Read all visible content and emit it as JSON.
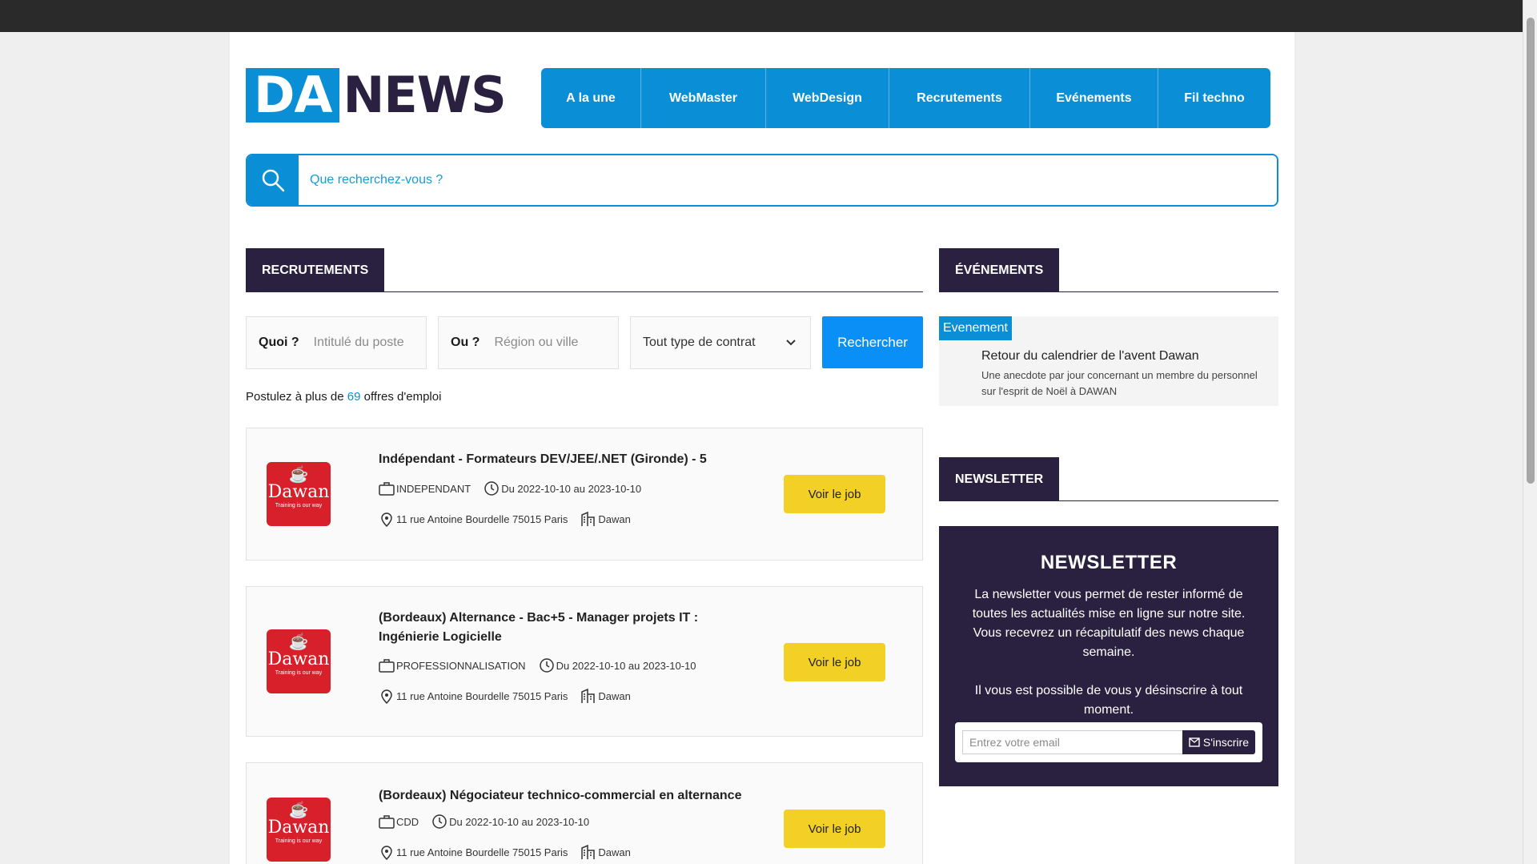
{
  "logo": {
    "part1": "DA",
    "part2": "NEWS"
  },
  "nav": [
    {
      "label": "A la une",
      "width": 125
    },
    {
      "label": "WebMaster",
      "width": 156
    },
    {
      "label": "WebDesign",
      "width": 154
    },
    {
      "label": "Recrutements",
      "width": 176
    },
    {
      "label": "Evénements",
      "width": 160
    },
    {
      "label": "Fil techno",
      "width": 140
    }
  ],
  "search": {
    "placeholder": "Que recherchez-vous ?"
  },
  "recrutements": {
    "heading": "RECRUTEMENTS",
    "quoi_label": "Quoi ?",
    "quoi_placeholder": "Intitulé du poste",
    "ou_label": "Ou ?",
    "ou_placeholder": "Région ou ville",
    "contract_select": "Tout type de contrat",
    "search_button": "Rechercher",
    "count_prefix": "Postulez à plus de",
    "count_value": "69",
    "count_suffix": "offres d'emploi"
  },
  "jobs": [
    {
      "title": "Indépendant - Formateurs DEV/JEE/.NET (Gironde) - 5",
      "contract": "INDEPENDANT",
      "dates": "Du 2022-10-10 au 2023-10-10",
      "address": "11 rue Antoine Bourdelle 75015 Paris",
      "company": "Dawan",
      "button": "Voir le job"
    },
    {
      "title": "(Bordeaux) Alternance - Bac+5 - Manager projets IT : Ingénierie Logicielle",
      "contract": "PROFESSIONNALISATION",
      "dates": "Du 2022-10-10 au 2023-10-10",
      "address": "11 rue Antoine Bourdelle 75015 Paris",
      "company": "Dawan",
      "button": "Voir le job"
    },
    {
      "title": "(Bordeaux) Négociateur technico-commercial en alternance",
      "contract": "CDD",
      "dates": "Du 2022-10-10 au 2023-10-10",
      "address": "11 rue Antoine Bourdelle 75015 Paris",
      "company": "Dawan",
      "button": "Voir le job"
    }
  ],
  "company_logo": {
    "brand": "Dawan",
    "tagline": "Training is our way"
  },
  "evenements": {
    "heading": "ÉVÉNEMENTS",
    "badge": "Evenement",
    "title": "Retour du calendrier de l'avent Dawan",
    "description": "Une anecdote par jour concernant un membre du personnel sur l'esprit de Noël à DAWAN"
  },
  "newsletter": {
    "heading": "NEWSLETTER",
    "box_title": "NEWSLETTER",
    "text1": "La newsletter vous permet de rester informé de toutes les actualités mise en ligne sur notre site. Vous recevrez un récapitulatif des news chaque semaine.",
    "text2": "Il vous est possible de vous y désinscrire à tout moment.",
    "email_placeholder": "Entrez votre email",
    "subscribe_label": "S'inscrire"
  },
  "colors": {
    "primary": "#0a8fd6",
    "dark": "#2a2140",
    "yellow": "#f2d026",
    "dawan_red": "#d8202a"
  }
}
